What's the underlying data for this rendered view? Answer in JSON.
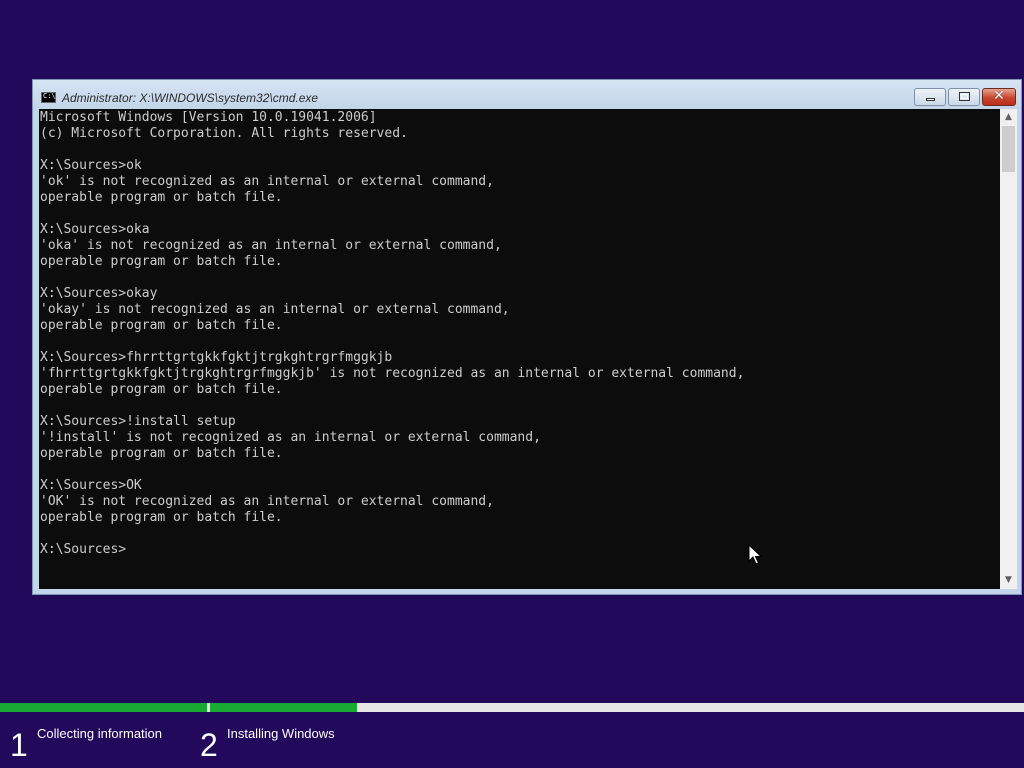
{
  "window": {
    "title": "Administrator: X:\\WINDOWS\\system32\\cmd.exe",
    "icon": "cmd-icon",
    "icon_text": "C:\\",
    "close_glyph": "✕"
  },
  "console": {
    "lines": [
      "Microsoft Windows [Version 10.0.19041.2006]",
      "(c) Microsoft Corporation. All rights reserved.",
      "",
      "X:\\Sources>ok",
      "'ok' is not recognized as an internal or external command,",
      "operable program or batch file.",
      "",
      "X:\\Sources>oka",
      "'oka' is not recognized as an internal or external command,",
      "operable program or batch file.",
      "",
      "X:\\Sources>okay",
      "'okay' is not recognized as an internal or external command,",
      "operable program or batch file.",
      "",
      "X:\\Sources>fhrrttgrtgkkfgktjtrgkghtrgrfmggkjb",
      "'fhrrttgrtgkkfgktjtrgkghtrgrfmggkjb' is not recognized as an internal or external command,",
      "operable program or batch file.",
      "",
      "X:\\Sources>!install setup",
      "'!install' is not recognized as an internal or external command,",
      "operable program or batch file.",
      "",
      "X:\\Sources>OK",
      "'OK' is not recognized as an internal or external command,",
      "operable program or batch file.",
      "",
      "X:\\Sources>"
    ]
  },
  "setup": {
    "steps": [
      {
        "number": "1",
        "label": "Collecting information",
        "progress": 1.0
      },
      {
        "number": "2",
        "label": "Installing Windows",
        "progress": 0.18
      }
    ]
  },
  "colors": {
    "desktop": "#22095c",
    "progress_fill": "#18aa32",
    "progress_track": "#e6e6e6",
    "console_bg": "#0c0c0c",
    "console_text": "#cccccc"
  }
}
